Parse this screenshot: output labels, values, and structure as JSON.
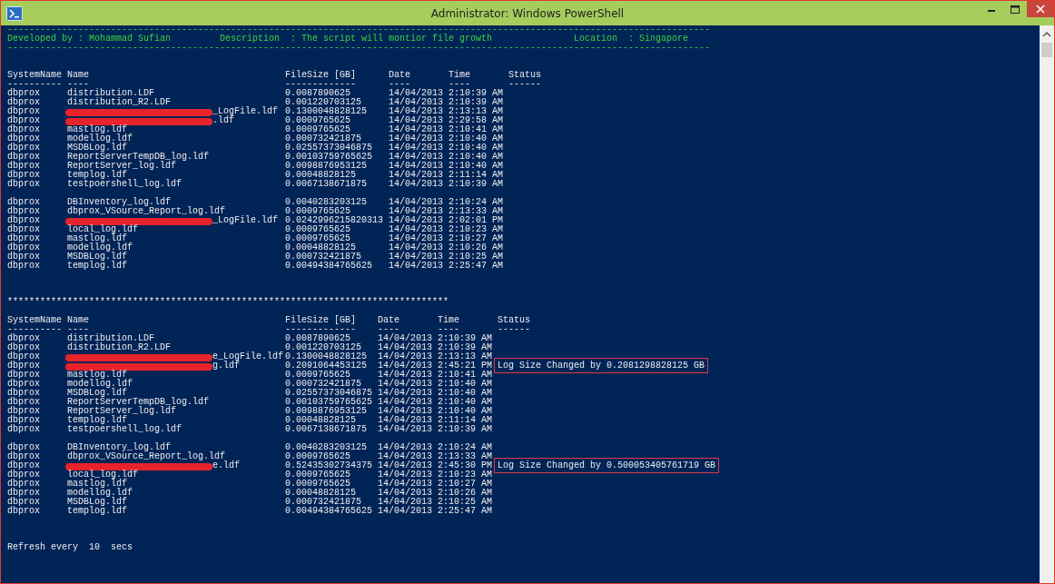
{
  "window": {
    "title": "Administrator: Windows PowerShell"
  },
  "banner": {
    "rule": "---------------------------------------------------------------------------------------------------------------------------------",
    "fields": [
      "Developed by : Mohammad Sufian",
      "Description  : The script will montior file growth",
      "Location  : Singapore"
    ]
  },
  "tables": [
    {
      "columns": [
        {
          "label": "SystemName",
          "underline": "----------"
        },
        {
          "label": "Name",
          "underline": "----"
        },
        {
          "label": "FileSize [GB]",
          "underline": "-------------"
        },
        {
          "label": "Date",
          "underline": "----"
        },
        {
          "label": "Time",
          "underline": "----"
        },
        {
          "label": "Status",
          "underline": "------"
        }
      ],
      "groups": [
        [
          {
            "system": "dbprox",
            "name": "distribution.LDF",
            "redacted": false,
            "size": "0.0087890625",
            "date": "14/04/2013",
            "time": "2:10:39 AM"
          },
          {
            "system": "dbprox",
            "name": "distribution_R2.LDF",
            "redacted": false,
            "size": "0.001220703125",
            "date": "14/04/2013",
            "time": "2:10:39 AM"
          },
          {
            "system": "dbprox",
            "name": "_LogFile.ldf",
            "redacted": true,
            "size": "0.1300048828125",
            "date": "14/04/2013",
            "time": "2:13:13 AM"
          },
          {
            "system": "dbprox",
            "name": ".ldf",
            "redacted": true,
            "size": "0.0009765625",
            "date": "14/04/2013",
            "time": "2:29:58 AM"
          },
          {
            "system": "dbprox",
            "name": "mastlog.ldf",
            "redacted": false,
            "size": "0.0009765625",
            "date": "14/04/2013",
            "time": "2:10:41 AM"
          },
          {
            "system": "dbprox",
            "name": "modellog.ldf",
            "redacted": false,
            "size": "0.000732421875",
            "date": "14/04/2013",
            "time": "2:10:40 AM"
          },
          {
            "system": "dbprox",
            "name": "MSDBLog.ldf",
            "redacted": false,
            "size": "0.02557373046875",
            "date": "14/04/2013",
            "time": "2:10:40 AM"
          },
          {
            "system": "dbprox",
            "name": "ReportServerTempDB_log.ldf",
            "redacted": false,
            "size": "0.00103759765625",
            "date": "14/04/2013",
            "time": "2:10:40 AM"
          },
          {
            "system": "dbprox",
            "name": "ReportServer_log.ldf",
            "redacted": false,
            "size": "0.0098876953125",
            "date": "14/04/2013",
            "time": "2:10:40 AM"
          },
          {
            "system": "dbprox",
            "name": "templog.ldf",
            "redacted": false,
            "size": "0.00048828125",
            "date": "14/04/2013",
            "time": "2:11:14 AM"
          },
          {
            "system": "dbprox",
            "name": "testpoershell_log.ldf",
            "redacted": false,
            "size": "0.0067138671875",
            "date": "14/04/2013",
            "time": "2:10:39 AM"
          }
        ],
        [
          {
            "system": "dbprox",
            "name": "DBInventory_log.ldf",
            "redacted": false,
            "size": "0.0040283203125",
            "date": "14/04/2013",
            "time": "2:10:24 AM"
          },
          {
            "system": "dbprox",
            "name": "dbprox_VSource_Report_log.ldf",
            "redacted": false,
            "size": "0.0009765625",
            "date": "14/04/2013",
            "time": "2:13:33 AM"
          },
          {
            "system": "dbprox",
            "name": "_LogFile.ldf",
            "redacted": true,
            "size": "0.0242996215820313",
            "date": "14/04/2013",
            "time": "2:02:01 PM"
          },
          {
            "system": "dbprox",
            "name": "local_log.ldf",
            "redacted": false,
            "size": "0.0009765625",
            "date": "14/04/2013",
            "time": "2:10:23 AM"
          },
          {
            "system": "dbprox",
            "name": "mastlog.ldf",
            "redacted": false,
            "size": "0.0009765625",
            "date": "14/04/2013",
            "time": "2:10:27 AM"
          },
          {
            "system": "dbprox",
            "name": "modellog.ldf",
            "redacted": false,
            "size": "0.00048828125",
            "date": "14/04/2013",
            "time": "2:10:26 AM"
          },
          {
            "system": "dbprox",
            "name": "MSDBLog.ldf",
            "redacted": false,
            "size": "0.000732421875",
            "date": "14/04/2013",
            "time": "2:10:25 AM"
          },
          {
            "system": "dbprox",
            "name": "templog.ldf",
            "redacted": false,
            "size": "0.00494384765625",
            "date": "14/04/2013",
            "time": "2:25:47 AM"
          }
        ]
      ]
    },
    {
      "columns": [
        {
          "label": "SystemName",
          "underline": "----------"
        },
        {
          "label": "Name",
          "underline": "----"
        },
        {
          "label": "FileSize [GB]",
          "underline": "-------------"
        },
        {
          "label": "Date",
          "underline": "----"
        },
        {
          "label": "Time",
          "underline": "----"
        },
        {
          "label": "Status",
          "underline": "------"
        }
      ],
      "groups": [
        [
          {
            "system": "dbprox",
            "name": "distribution.LDF",
            "redacted": false,
            "size": "0.0087890625",
            "date": "14/04/2013",
            "time": "2:10:39 AM"
          },
          {
            "system": "dbprox",
            "name": "distribution_R2.LDF",
            "redacted": false,
            "size": "0.001220703125",
            "date": "14/04/2013",
            "time": "2:10:39 AM"
          },
          {
            "system": "dbprox",
            "name": "e_LogFile.ldf",
            "redacted": true,
            "size": "0.1300048828125",
            "date": "14/04/2013",
            "time": "2:13:13 AM"
          },
          {
            "system": "dbprox",
            "name": "g.ldf",
            "redacted": true,
            "size": "0.2091064453125",
            "date": "14/04/2013",
            "time": "2:45:21 PM",
            "status": "Log Size Changed by 0.2081298828125 GB"
          },
          {
            "system": "dbprox",
            "name": "mastlog.ldf",
            "redacted": false,
            "size": "0.0009765625",
            "date": "14/04/2013",
            "time": "2:10:41 AM"
          },
          {
            "system": "dbprox",
            "name": "modellog.ldf",
            "redacted": false,
            "size": "0.000732421875",
            "date": "14/04/2013",
            "time": "2:10:40 AM"
          },
          {
            "system": "dbprox",
            "name": "MSDBLog.ldf",
            "redacted": false,
            "size": "0.02557373046875",
            "date": "14/04/2013",
            "time": "2:10:40 AM"
          },
          {
            "system": "dbprox",
            "name": "ReportServerTempDB_log.ldf",
            "redacted": false,
            "size": "0.00103759765625",
            "date": "14/04/2013",
            "time": "2:10:40 AM"
          },
          {
            "system": "dbprox",
            "name": "ReportServer_log.ldf",
            "redacted": false,
            "size": "0.0098876953125",
            "date": "14/04/2013",
            "time": "2:10:40 AM"
          },
          {
            "system": "dbprox",
            "name": "templog.ldf",
            "redacted": false,
            "size": "0.00048828125",
            "date": "14/04/2013",
            "time": "2:11:14 AM"
          },
          {
            "system": "dbprox",
            "name": "testpoershell_log.ldf",
            "redacted": false,
            "size": "0.0067138671875",
            "date": "14/04/2013",
            "time": "2:10:39 AM"
          }
        ],
        [
          {
            "system": "dbprox",
            "name": "DBInventory_log.ldf",
            "redacted": false,
            "size": "0.0040283203125",
            "date": "14/04/2013",
            "time": "2:10:24 AM"
          },
          {
            "system": "dbprox",
            "name": "dbprox_VSource_Report_log.ldf",
            "redacted": false,
            "size": "0.0009765625",
            "date": "14/04/2013",
            "time": "2:13:33 AM"
          },
          {
            "system": "dbprox",
            "name": "e.ldf",
            "redacted": true,
            "size": "0.52435302734375",
            "date": "14/04/2013",
            "time": "2:45:30 PM",
            "status": "Log Size Changed by 0.500053405761719 GB"
          },
          {
            "system": "dbprox",
            "name": "local_log.ldf",
            "redacted": false,
            "size": "0.0009765625",
            "date": "14/04/2013",
            "time": "2:10:23 AM"
          },
          {
            "system": "dbprox",
            "name": "mastlog.ldf",
            "redacted": false,
            "size": "0.0009765625",
            "date": "14/04/2013",
            "time": "2:10:27 AM"
          },
          {
            "system": "dbprox",
            "name": "modellog.ldf",
            "redacted": false,
            "size": "0.00048828125",
            "date": "14/04/2013",
            "time": "2:10:26 AM"
          },
          {
            "system": "dbprox",
            "name": "MSDBLog.ldf",
            "redacted": false,
            "size": "0.000732421875",
            "date": "14/04/2013",
            "time": "2:10:25 AM"
          },
          {
            "system": "dbprox",
            "name": "templog.ldf",
            "redacted": false,
            "size": "0.00494384765625",
            "date": "14/04/2013",
            "time": "2:25:47 AM"
          }
        ]
      ]
    }
  ],
  "separator": "*********************************************************************************",
  "footer": "Refresh every  10  secs"
}
